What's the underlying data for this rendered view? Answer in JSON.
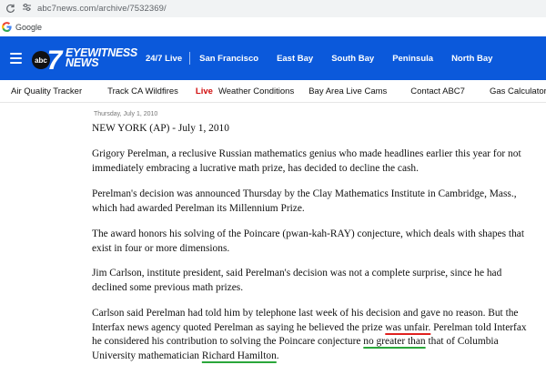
{
  "browser": {
    "url": "abc7news.com/archive/7532369/",
    "bookmark": "Google"
  },
  "header": {
    "logo_line1": "EYEWITNESS",
    "logo_line2": "NEWS",
    "logo_abc": "abc",
    "logo_seven": "7",
    "nav": [
      "24/7 Live",
      "San Francisco",
      "East Bay",
      "South Bay",
      "Peninsula",
      "North Bay"
    ]
  },
  "subnav": {
    "items": [
      "Air Quality Tracker",
      "Track CA Wildfires",
      "Live",
      "Weather Conditions",
      "Bay Area Live Cams",
      "Contact ABC7",
      "Gas Calculator"
    ]
  },
  "article": {
    "date_small": "Thursday, July 1, 2010",
    "p1": "NEW YORK (AP) - July 1, 2010",
    "p2_l1": "Grigory Perelman, a reclusive Russian mathematics genius who made headlines earlier this year for not",
    "p2_l2": "immediately embracing a lucrative math prize, has decided to decline the cash.",
    "p3_l1": "Perelman's decision was announced Thursday by the Clay Mathematics Institute in Cambridge, Mass.,",
    "p3_l2": "which had awarded Perelman its Millennium Prize.",
    "p4_l1": "The award honors his solving of the Poincare (pwan-kah-RAY) conjecture, which deals with shapes that",
    "p4_l2": "exist in four or more dimensions.",
    "p5_l1": "Jim Carlson, institute president, said Perelman's decision was not a complete surprise, since he had",
    "p5_l2": "declined some previous math prizes.",
    "p6_l1": "Carlson said Perelman had told him by telephone last week of his decision and gave no reason. But the",
    "p6_l2a": "Interfax news agency quoted Perelman as saying he believed the prize ",
    "p6_l2b": "was unfair.",
    "p6_l2c": " Perelman told Interfax",
    "p6_l3a": "he considered his contribution to solving the Poincare conjecture ",
    "p6_l3b": "no greater than",
    "p6_l3c": " that of Columbia",
    "p6_l4a": "University mathematician ",
    "p6_l4b": "Richard Hamilton",
    "p6_l4c": "."
  },
  "colors": {
    "header_blue": "#0b59db",
    "live_red": "#d10d0d",
    "underline_red": "#e0211f",
    "underline_green": "#2aa63a"
  }
}
